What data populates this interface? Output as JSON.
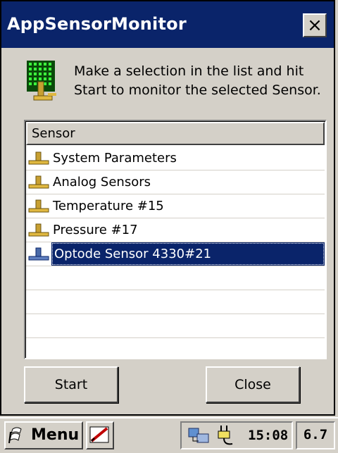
{
  "window": {
    "title": "AppSensorMonitor",
    "close_label": "×",
    "instructions": "Make a selection in the list and hit Start to monitor the selected Sensor."
  },
  "list": {
    "header": "Sensor",
    "items": [
      {
        "label": "System Parameters",
        "icon": "sensor-icon",
        "selected": false
      },
      {
        "label": "Analog Sensors",
        "icon": "sensor-icon",
        "selected": false
      },
      {
        "label": "Temperature #15",
        "icon": "sensor-icon",
        "selected": false
      },
      {
        "label": "Pressure #17",
        "icon": "sensor-icon",
        "selected": false
      },
      {
        "label": "Optode Sensor 4330#21",
        "icon": "sensor-icon",
        "selected": true
      }
    ]
  },
  "buttons": {
    "start_label": "Start",
    "close_label": "Close"
  },
  "taskbar": {
    "menu_label": "Menu",
    "clock": "15:08",
    "version": "6.7"
  },
  "colors": {
    "titlebar": "#0a246a",
    "selection": "#0a246a",
    "face": "#d4d0c8"
  }
}
